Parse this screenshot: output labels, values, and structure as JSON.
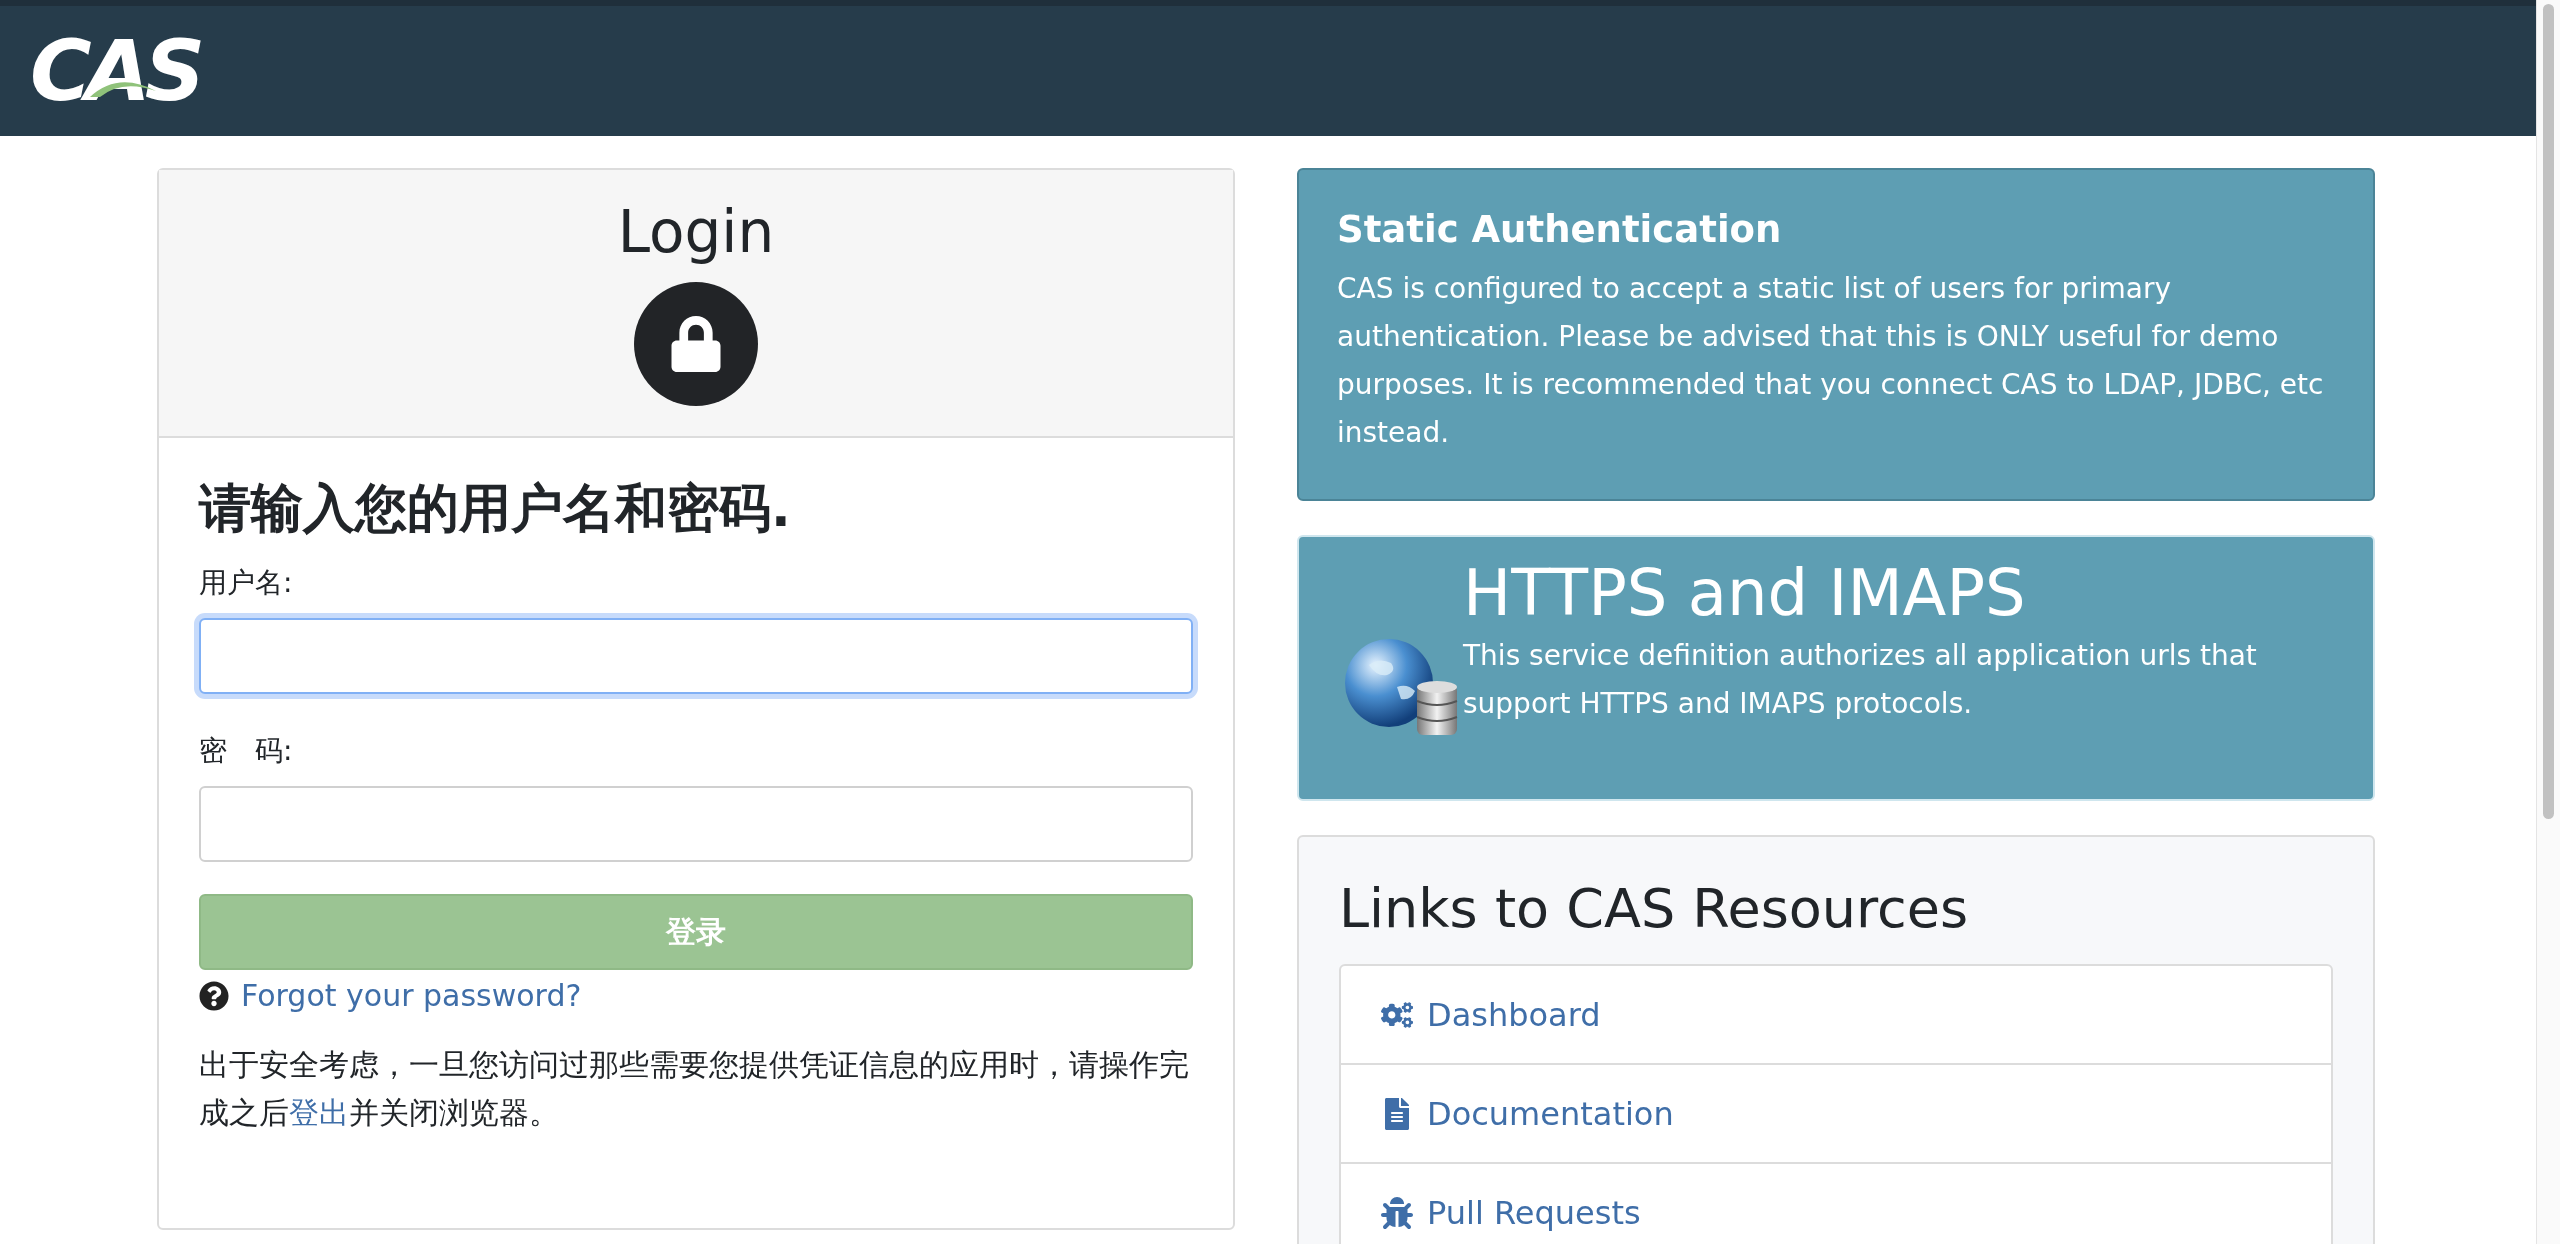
{
  "header": {
    "logo": "CAS"
  },
  "login": {
    "title": "Login",
    "heading": "请输入您的用户名和密码.",
    "fields": [
      {
        "label": "用户名:",
        "focused": true
      },
      {
        "label": "密　码:",
        "focused": false
      }
    ],
    "submit": {
      "label": "登录",
      "disabled": true
    },
    "forgot": "Forgot your password?",
    "notice": {
      "before": "出于安全考虑，一旦您访问过那些需要您提供凭证信息的应用时，请操作完成之后",
      "link": "登出",
      "after": "并关闭浏览器。"
    }
  },
  "static_auth": {
    "title": "Static Authentication",
    "text": "CAS is configured to accept a static list of users for primary authentication. Please be advised that this is ONLY useful for demo purposes. It is recommended that you connect CAS to LDAP, JDBC, etc instead."
  },
  "service": {
    "title": "HTTPS and IMAPS",
    "text": "This service definition authorizes all application urls that support HTTPS and IMAPS protocols."
  },
  "resources": {
    "title": "Links to CAS Resources",
    "links": [
      {
        "label": "Dashboard",
        "kind": "gears"
      },
      {
        "label": "Documentation",
        "kind": "file"
      },
      {
        "label": "Pull Requests",
        "kind": "bug"
      }
    ]
  }
}
